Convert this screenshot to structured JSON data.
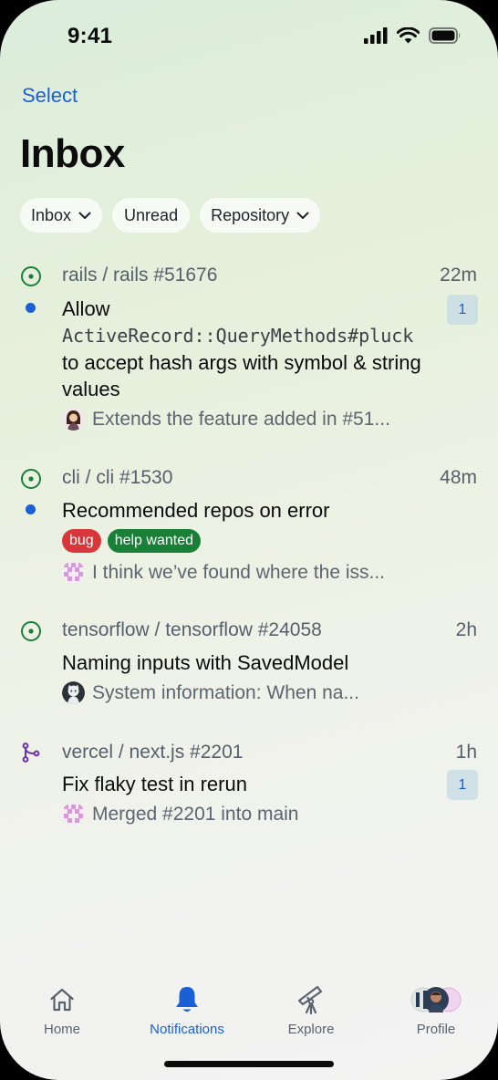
{
  "status_bar": {
    "time": "9:41"
  },
  "header": {
    "select_label": "Select",
    "title": "Inbox"
  },
  "filters": [
    {
      "label": "Inbox",
      "has_dropdown": true
    },
    {
      "label": "Unread",
      "has_dropdown": false
    },
    {
      "label": "Repository",
      "has_dropdown": true
    }
  ],
  "notifications": [
    {
      "repo": "rails / rails #51676",
      "time": "22m",
      "count": "1",
      "unread": true,
      "type": "issue-open-icon",
      "title_before": "Allow",
      "title_code": "ActiveRecord::QueryMethods#pluck",
      "title_after": "to accept hash args with symbol & string values",
      "snippet": "Extends the feature added in #51..."
    },
    {
      "repo": "cli / cli #1530",
      "time": "48m",
      "unread": true,
      "type": "issue-open-icon",
      "title": "Recommended repos on error",
      "labels": [
        {
          "name": "bug",
          "color": "#d7373a"
        },
        {
          "name": "help wanted",
          "color": "#1a7f37"
        }
      ],
      "snippet": "I think we’ve found where the iss..."
    },
    {
      "repo": "tensorflow / tensorflow #24058",
      "time": "2h",
      "unread": false,
      "type": "issue-open-icon",
      "title": "Naming inputs with SavedModel",
      "snippet": "System information: When na..."
    },
    {
      "repo": "vercel / next.js #2201",
      "time": "1h",
      "count": "1",
      "unread": false,
      "type": "pull-request-merged-icon",
      "title": "Fix flaky test in rerun",
      "snippet": "Merged #2201 into main"
    }
  ],
  "tab_bar": [
    {
      "label": "Home",
      "icon": "home-icon"
    },
    {
      "label": "Notifications",
      "icon": "bell-icon",
      "active": true
    },
    {
      "label": "Explore",
      "icon": "telescope-icon"
    },
    {
      "label": "Profile",
      "icon": "avatar"
    }
  ],
  "colors": {
    "accent": "#1a5fd6",
    "open_state": "#1a7f37",
    "merged_state": "#6b2fb3"
  }
}
